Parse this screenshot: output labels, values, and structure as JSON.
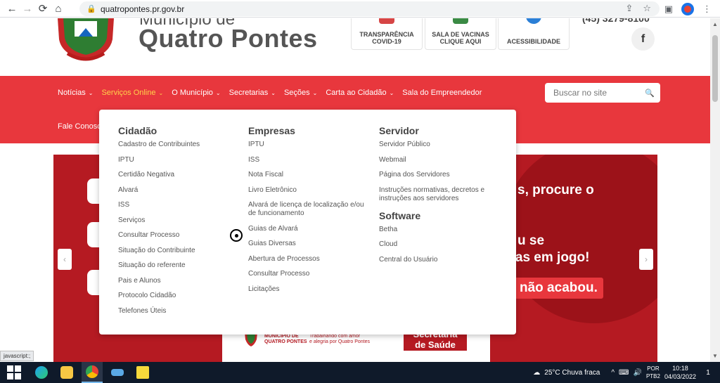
{
  "browser": {
    "url": "quatropontes.pr.gov.br"
  },
  "header": {
    "title_top": "Município de",
    "title_main": "Quatro Pontes",
    "boxes": [
      "TRANSPARÊNCIA COVID-19",
      "SALA DE VACINAS CLIQUE AQUI",
      "ACESSIBILIDADE"
    ],
    "phone": "(45) 3279-8100",
    "facebook_letter": "f"
  },
  "nav": {
    "items": [
      "Notícias",
      "Serviços Online",
      "O Município",
      "Secretarias",
      "Seções",
      "Carta ao Cidadão",
      "Sala do Empreendedor"
    ],
    "item2": "Fale Conosco",
    "search_placeholder": "Buscar no site"
  },
  "dropdown": {
    "cidadao": {
      "title": "Cidadão",
      "links": [
        "Cadastro de Contribuintes",
        "IPTU",
        "Certidão Negativa",
        "Alvará",
        "ISS",
        "Serviços",
        "Consultar Processo",
        "Situação do Contribuinte",
        "Situação do referente",
        "Pais e Alunos",
        "Protocolo Cidadão",
        "Telefones Úteis"
      ]
    },
    "empresas": {
      "title": "Empresas",
      "links": [
        "IPTU",
        "ISS",
        "Nota Fiscal",
        "Livro Eletrônico",
        "Alvará de licença de localização e/ou de funcionamento",
        "Guias de Alvará",
        "Guias Diversas",
        "Abertura de Processos",
        "Consultar Processo",
        "Licitações"
      ]
    },
    "servidor": {
      "title": "Servidor",
      "links": [
        "Servidor Público",
        "Webmail",
        "Página dos Servidores",
        "Instruções normativas, decretos e instruções aos servidores"
      ]
    },
    "software": {
      "title": "Software",
      "links": [
        "Betha",
        "Cloud",
        "Central do Usuário"
      ]
    }
  },
  "banner": {
    "line1": "s, procure o",
    "line2": "u se",
    "line3": "idas em jogo!",
    "pill": "não acabou.",
    "card_left": "MUNICÍPIO DE\nQUATRO PONTES",
    "card_right": "Trabalhando com amor\ne alegria por Quatro Pontes",
    "card_sec": "Secretaria\nde Saúde"
  },
  "status_tip": "javascript:;",
  "taskbar": {
    "weather": "25°C  Chuva fraca",
    "lang_1": "POR",
    "lang_2": "PTB2",
    "time": "10:18",
    "date": "04/03/2022",
    "notif_count": "1"
  },
  "colors": {
    "brand_red": "#e8373d",
    "active_nav": "#ffd24a",
    "banner_red": "#b51a22"
  }
}
